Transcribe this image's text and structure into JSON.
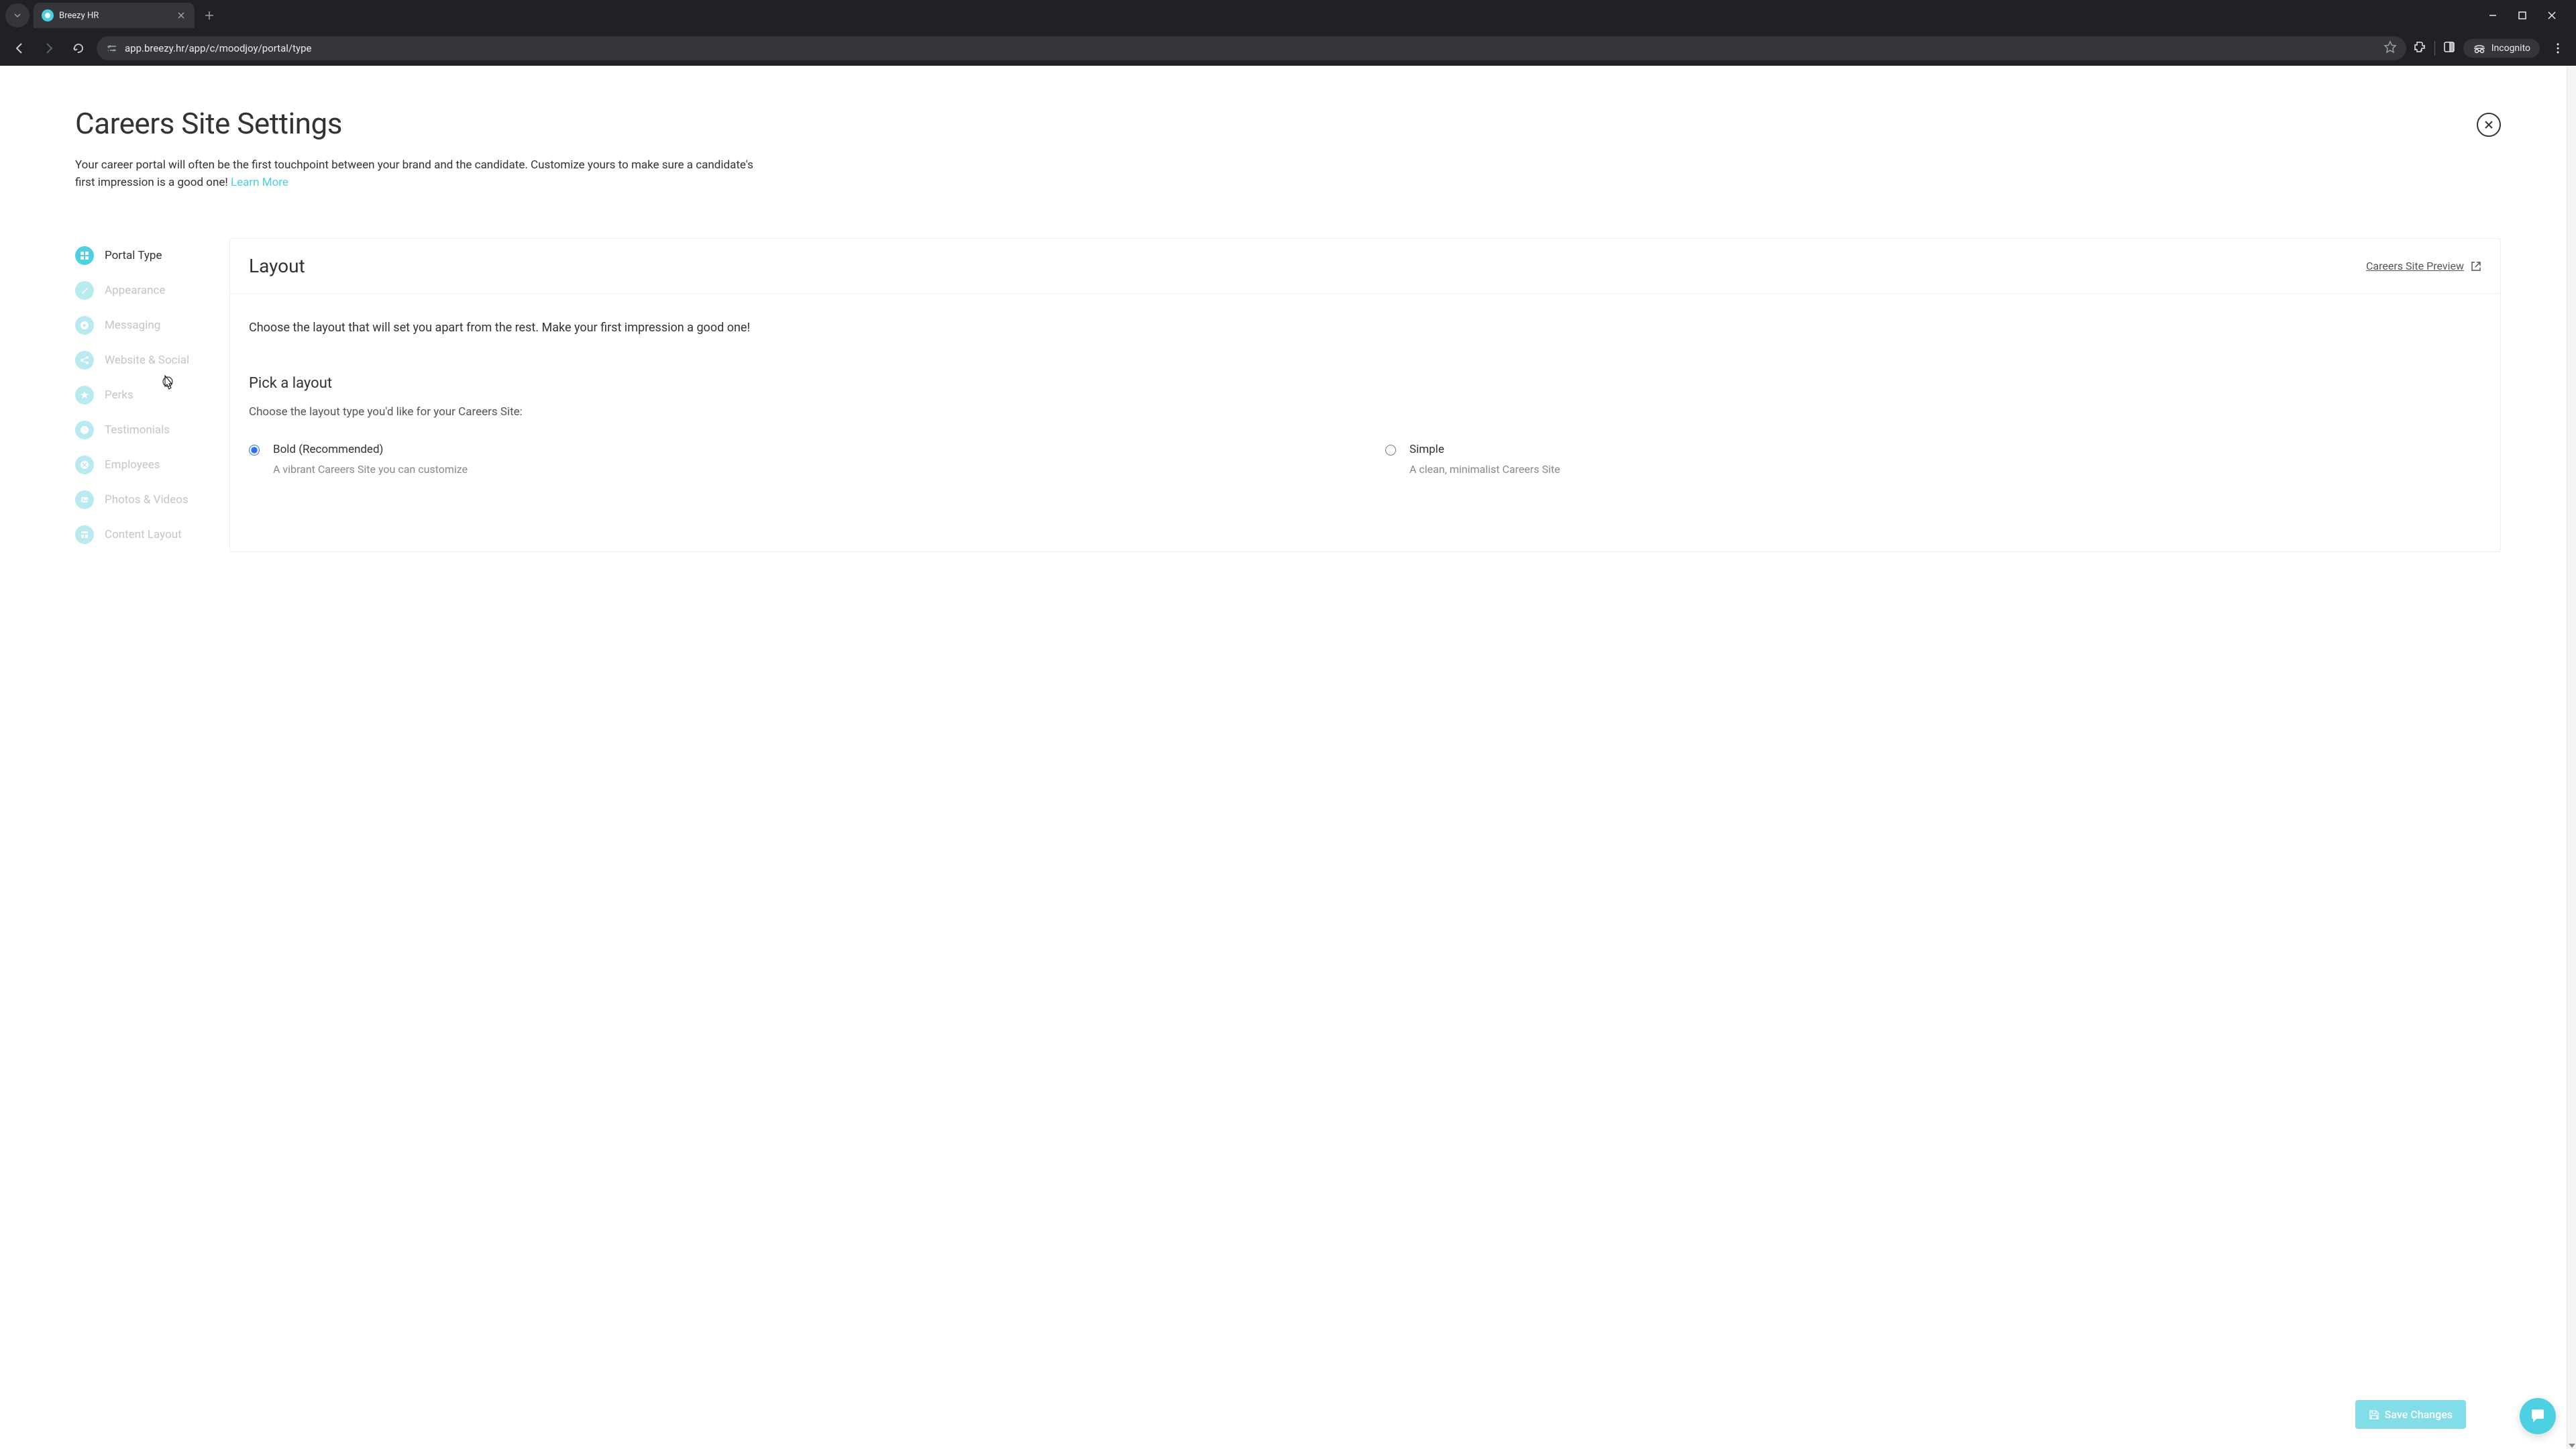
{
  "browser": {
    "tab_title": "Breezy HR",
    "url": "app.breezy.hr/app/c/moodjoy/portal/type",
    "incognito_label": "Incognito"
  },
  "page": {
    "title": "Careers Site Settings",
    "subtitle_1": "Your career portal will often be the first touchpoint between your brand and the candidate. Customize yours to make sure a candidate's first impression is a good one! ",
    "learn_more": "Learn More"
  },
  "nav": {
    "items": [
      {
        "label": "Portal Type",
        "icon": "grid"
      },
      {
        "label": "Appearance",
        "icon": "brush"
      },
      {
        "label": "Messaging",
        "icon": "play"
      },
      {
        "label": "Website & Social",
        "icon": "share"
      },
      {
        "label": "Perks",
        "icon": "star"
      },
      {
        "label": "Testimonials",
        "icon": "quote"
      },
      {
        "label": "Employees",
        "icon": "close"
      },
      {
        "label": "Photos & Videos",
        "icon": "image"
      },
      {
        "label": "Content Layout",
        "icon": "layout"
      }
    ]
  },
  "panel": {
    "title": "Layout",
    "preview_link": "Careers Site Preview",
    "description": "Choose the layout that will set you apart from the rest. Make your first impression a good one!",
    "section_title": "Pick a layout",
    "section_subtitle": "Choose the layout type you'd like for your Careers Site:",
    "options": [
      {
        "title": "Bold (Recommended)",
        "desc": "A vibrant Careers Site you can customize"
      },
      {
        "title": "Simple",
        "desc": "A clean, minimalist Careers Site"
      }
    ]
  },
  "actions": {
    "save": "Save Changes"
  }
}
